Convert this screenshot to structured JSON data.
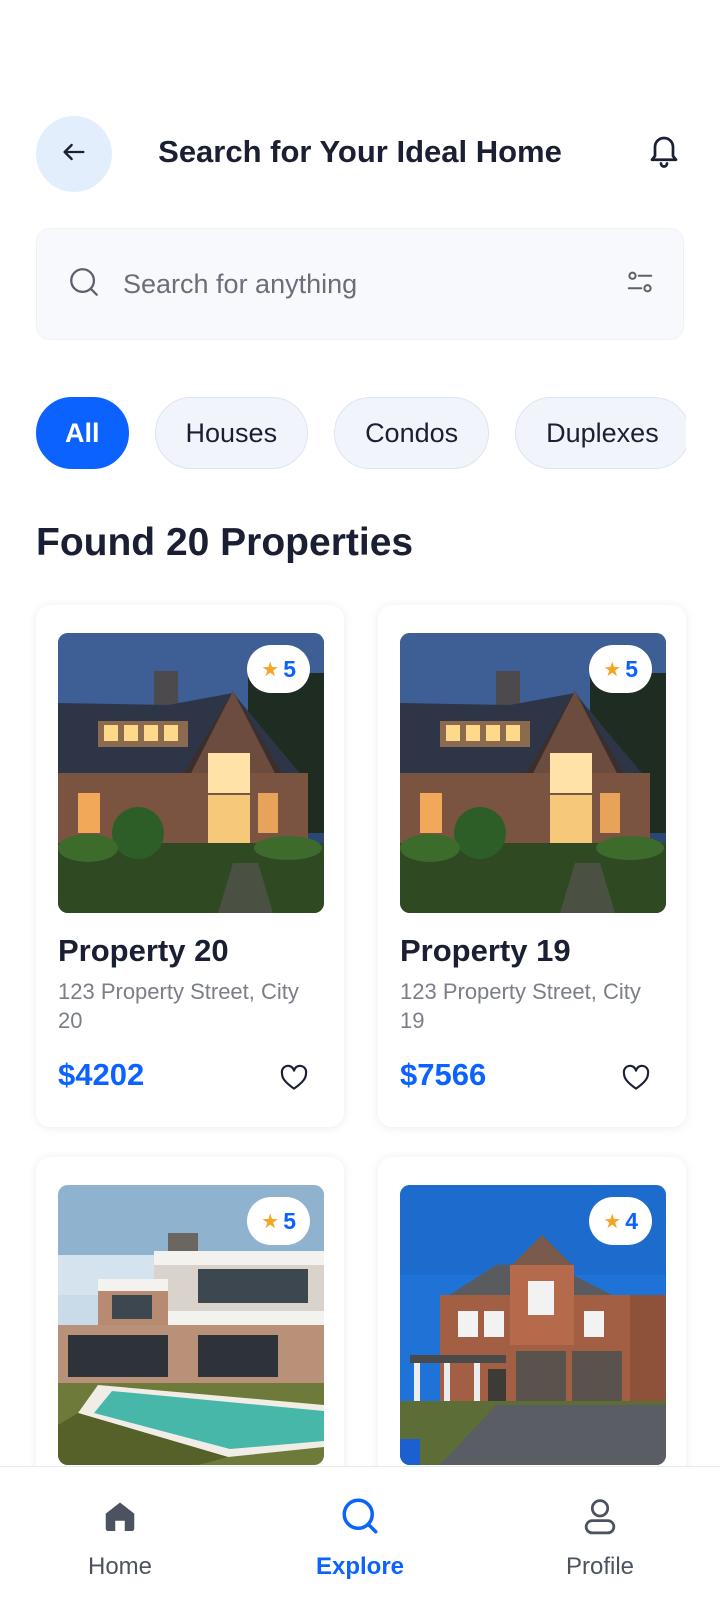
{
  "header": {
    "title": "Search for Your Ideal Home",
    "back_icon": "arrow-left-icon",
    "bell_icon": "bell-icon"
  },
  "search": {
    "placeholder": "Search for anything",
    "value": "",
    "search_icon": "search-icon",
    "filter_icon": "filter-sliders-icon"
  },
  "categories": {
    "selected": "All",
    "items": [
      "All",
      "Houses",
      "Condos",
      "Duplexes"
    ]
  },
  "results": {
    "title": "Found 20 Properties"
  },
  "properties": [
    {
      "name": "Property 20",
      "address": "123 Property Street, City 20",
      "price": "$4202",
      "rating": "5",
      "photo": "house-at-dusk"
    },
    {
      "name": "Property 19",
      "address": "123 Property Street, City 19",
      "price": "$7566",
      "rating": "5",
      "photo": "house-at-dusk"
    },
    {
      "name": "",
      "address": "",
      "price": "",
      "rating": "5",
      "photo": "modern-house-with-pool"
    },
    {
      "name": "",
      "address": "",
      "price": "",
      "rating": "4",
      "photo": "brick-house-with-garage"
    }
  ],
  "bottom_nav": {
    "active": "Explore",
    "items": [
      {
        "label": "Home",
        "icon": "home-icon"
      },
      {
        "label": "Explore",
        "icon": "search-icon"
      },
      {
        "label": "Profile",
        "icon": "user-icon"
      }
    ]
  },
  "colors": {
    "primary": "#0b62ff",
    "star": "#f5a524",
    "back_button_bg": "#e3eefd",
    "text_dark": "#1b1f33",
    "text_muted": "#7a7e88"
  }
}
